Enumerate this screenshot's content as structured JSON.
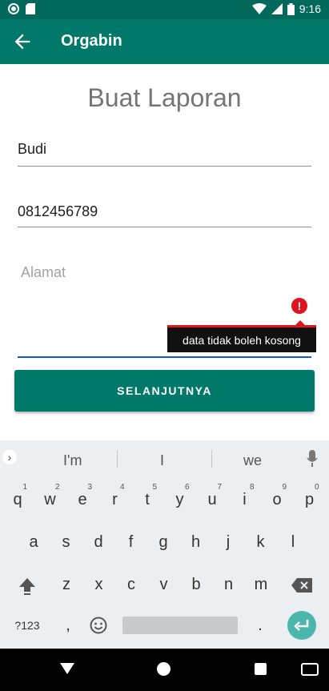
{
  "status_bar": {
    "time": "9:16",
    "icons": [
      "circle-icon",
      "sd-card-icon",
      "wifi-icon",
      "signal-icon",
      "battery-icon"
    ]
  },
  "app_bar": {
    "title": "Orgabin",
    "back_icon": "arrow-back-icon"
  },
  "form": {
    "heading": "Buat Laporan",
    "name_value": "Budi",
    "phone_value": "0812456789",
    "address_placeholder": "Alamat",
    "error_message": "data tidak boleh kosong",
    "next_label": "SELANJUTNYA"
  },
  "keyboard": {
    "suggestions": [
      "I'm",
      "I",
      "we"
    ],
    "row1": [
      {
        "k": "q",
        "n": "1"
      },
      {
        "k": "w",
        "n": "2"
      },
      {
        "k": "e",
        "n": "3"
      },
      {
        "k": "r",
        "n": "4"
      },
      {
        "k": "t",
        "n": "5"
      },
      {
        "k": "y",
        "n": "6"
      },
      {
        "k": "u",
        "n": "7"
      },
      {
        "k": "i",
        "n": "8"
      },
      {
        "k": "o",
        "n": "9"
      },
      {
        "k": "p",
        "n": "0"
      }
    ],
    "row2": [
      "a",
      "s",
      "d",
      "f",
      "g",
      "h",
      "j",
      "k",
      "l"
    ],
    "row3": [
      "z",
      "x",
      "c",
      "v",
      "b",
      "n",
      "m"
    ],
    "symbols_label": "?123",
    "comma_label": ",",
    "period_label": "."
  },
  "colors": {
    "primary": "#00796B",
    "primary_dark": "#00695C",
    "error": "#E0141E",
    "focus_line": "#1A57C7"
  }
}
